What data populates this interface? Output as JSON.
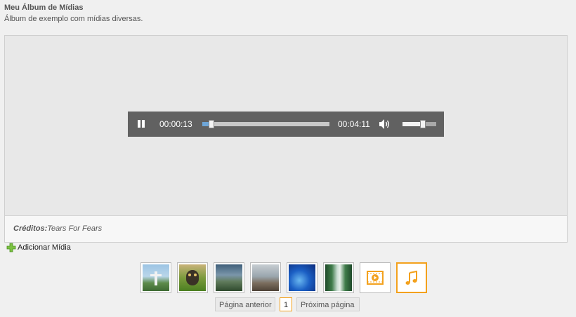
{
  "album": {
    "title": "Meu Álbum de Mídias",
    "description": "Álbum de exemplo com mídias diversas."
  },
  "player": {
    "current_time": "00:00:13",
    "duration": "00:04:11",
    "progress_fraction": 0.05,
    "volume_fraction": 0.6,
    "state": "playing"
  },
  "credits": {
    "label": "Créditos:",
    "value": "Tears For Fears"
  },
  "add_media": {
    "label": "Adicionar Mídia"
  },
  "thumbnails": [
    {
      "kind": "image",
      "icon": "christ-redeemer-photo"
    },
    {
      "kind": "image",
      "icon": "owl-on-grass-photo"
    },
    {
      "kind": "image",
      "icon": "cloudy-mountain-photo"
    },
    {
      "kind": "image",
      "icon": "misty-landscape-photo"
    },
    {
      "kind": "image",
      "icon": "blue-sea-photo"
    },
    {
      "kind": "image",
      "icon": "waterfall-forest-photo"
    },
    {
      "kind": "video",
      "icon": "video-icon"
    },
    {
      "kind": "audio",
      "icon": "music-note-icon",
      "selected": true
    }
  ],
  "pager": {
    "prev_label": "Página anterior",
    "current_page": "1",
    "next_label": "Próxima página"
  },
  "colors": {
    "accent": "#f3a11d",
    "player_bg": "#616161",
    "progress": "#6ea6d8"
  }
}
